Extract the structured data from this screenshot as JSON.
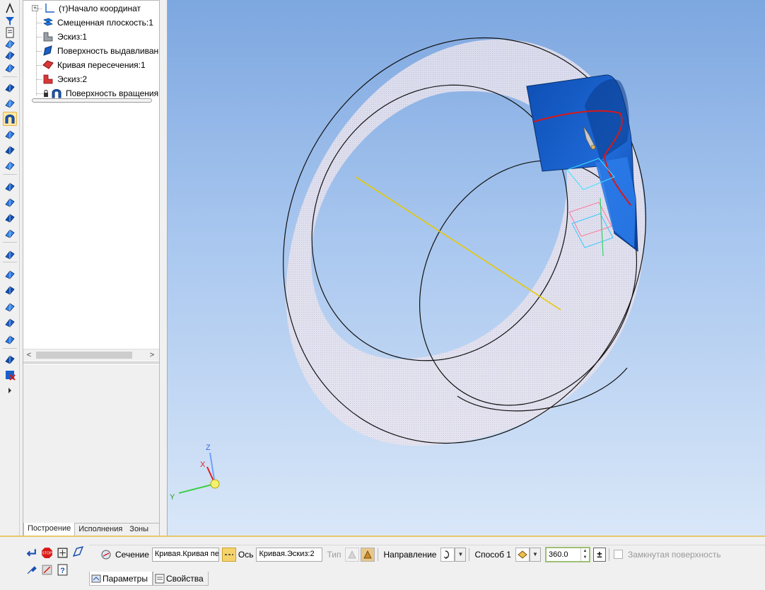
{
  "tree": {
    "items": [
      {
        "label": "(т)Начало координат",
        "icon": "origin-axes-icon"
      },
      {
        "label": "Смещенная плоскость:1",
        "icon": "offset-plane-icon"
      },
      {
        "label": "Эскиз:1",
        "icon": "sketch-icon"
      },
      {
        "label": "Поверхность выдавливания",
        "icon": "extrusion-surface-icon"
      },
      {
        "label": "Кривая пересечения:1",
        "icon": "intersection-curve-icon"
      },
      {
        "label": "Эскиз:2",
        "icon": "sketch-icon"
      },
      {
        "label": "Поверхность вращения",
        "icon": "revolution-surface-icon"
      }
    ],
    "tabs": [
      "Построение",
      "Исполнения",
      "Зоны"
    ],
    "active_tab": "Построение"
  },
  "left_toolbar": {
    "buttons": [
      "pointer-icon",
      "filter-icon",
      "document-icon",
      "plane-icon",
      "tree-icon",
      "hook-icon",
      "sketch-edit-icon",
      "extrude-surface-icon",
      "revolve-surface-icon",
      "kinematic-icon",
      "loft-icon",
      "patch-icon",
      "point-icon",
      "spline-icon",
      "polyline-icon",
      "helix-icon",
      "plane-offset-icon",
      "surface-trim-icon",
      "surface-extend-icon",
      "ruled-surface-icon",
      "sew-icon",
      "fill-icon",
      "mesh-icon",
      "delete-icon",
      "expand-icon"
    ]
  },
  "properties": {
    "section_label": "Сечение",
    "section_value": "Кривая.Кривая пе",
    "axis_label": "Ось",
    "axis_value": "Кривая.Эскиз:2",
    "type_label": "Тип",
    "direction_label": "Направление",
    "method_label": "Способ 1",
    "angle_value": "360.0",
    "closed_surface_label": "Замкнутая поверхность",
    "tabs": [
      "Параметры",
      "Свойства"
    ],
    "active_tab": "Параметры"
  },
  "viewport": {
    "axis_labels": {
      "z": "Z",
      "x": "X",
      "y": "Y"
    }
  },
  "colors": {
    "viewport_top": "#7da7e0",
    "viewport_bottom": "#d9e7f8",
    "surface_fill": "#1a5fc8",
    "curve_red": "#d81818",
    "axis_yellow": "#e8c800",
    "selection_highlight": "#ffe8a6"
  }
}
